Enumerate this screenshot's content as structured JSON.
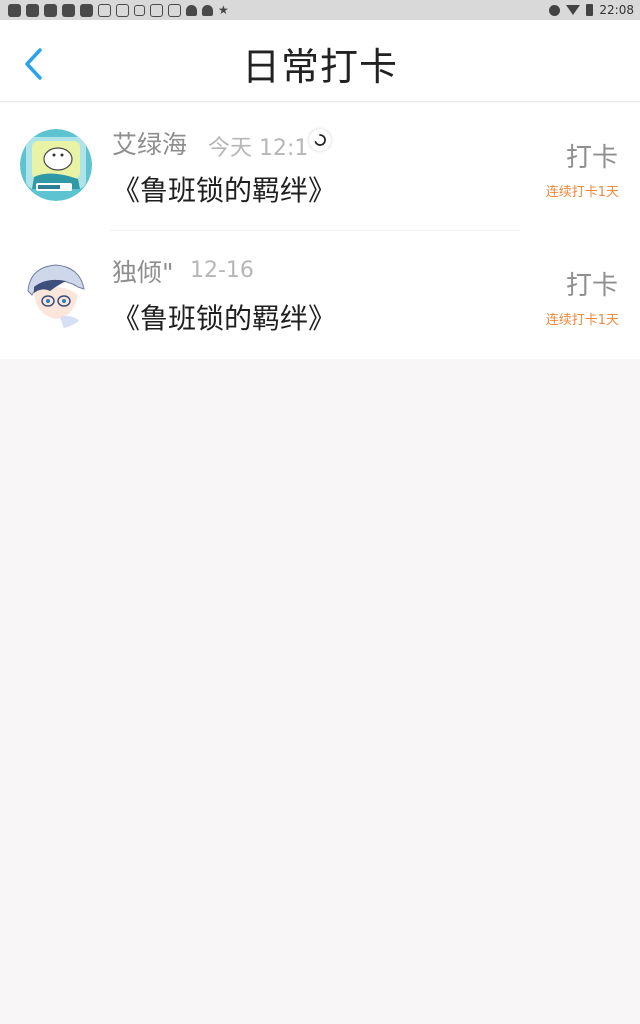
{
  "statusbar": {
    "time": "22:08",
    "icons_left": [
      "app-icon",
      "app-icon",
      "app-icon",
      "app-icon",
      "app-icon",
      "image-icon",
      "image-icon",
      "image-icon",
      "mail-icon",
      "mail-icon",
      "bell-icon",
      "bell-icon",
      "star-icon"
    ],
    "icons_right": [
      "dnd-icon",
      "wifi-icon",
      "battery-icon"
    ]
  },
  "header": {
    "title": "日常打卡",
    "back_icon": "chevron-left-icon",
    "accent_color": "#2aa3ef"
  },
  "items": [
    {
      "user": "艾绿海",
      "time": "今天 12:1",
      "book": "《鲁班锁的羁绊》",
      "action": "打卡",
      "streak": "连续打卡1天",
      "avatar_icon": "cartoon-avatar-icon"
    },
    {
      "user": "独倾\"",
      "time": "12-16",
      "book": "《鲁班锁的羁绊》",
      "action": "打卡",
      "streak": "连续打卡1天",
      "avatar_icon": "anime-avatar-icon"
    }
  ],
  "colors": {
    "streak": "#f08a3c",
    "background": "#f8f6f7"
  }
}
